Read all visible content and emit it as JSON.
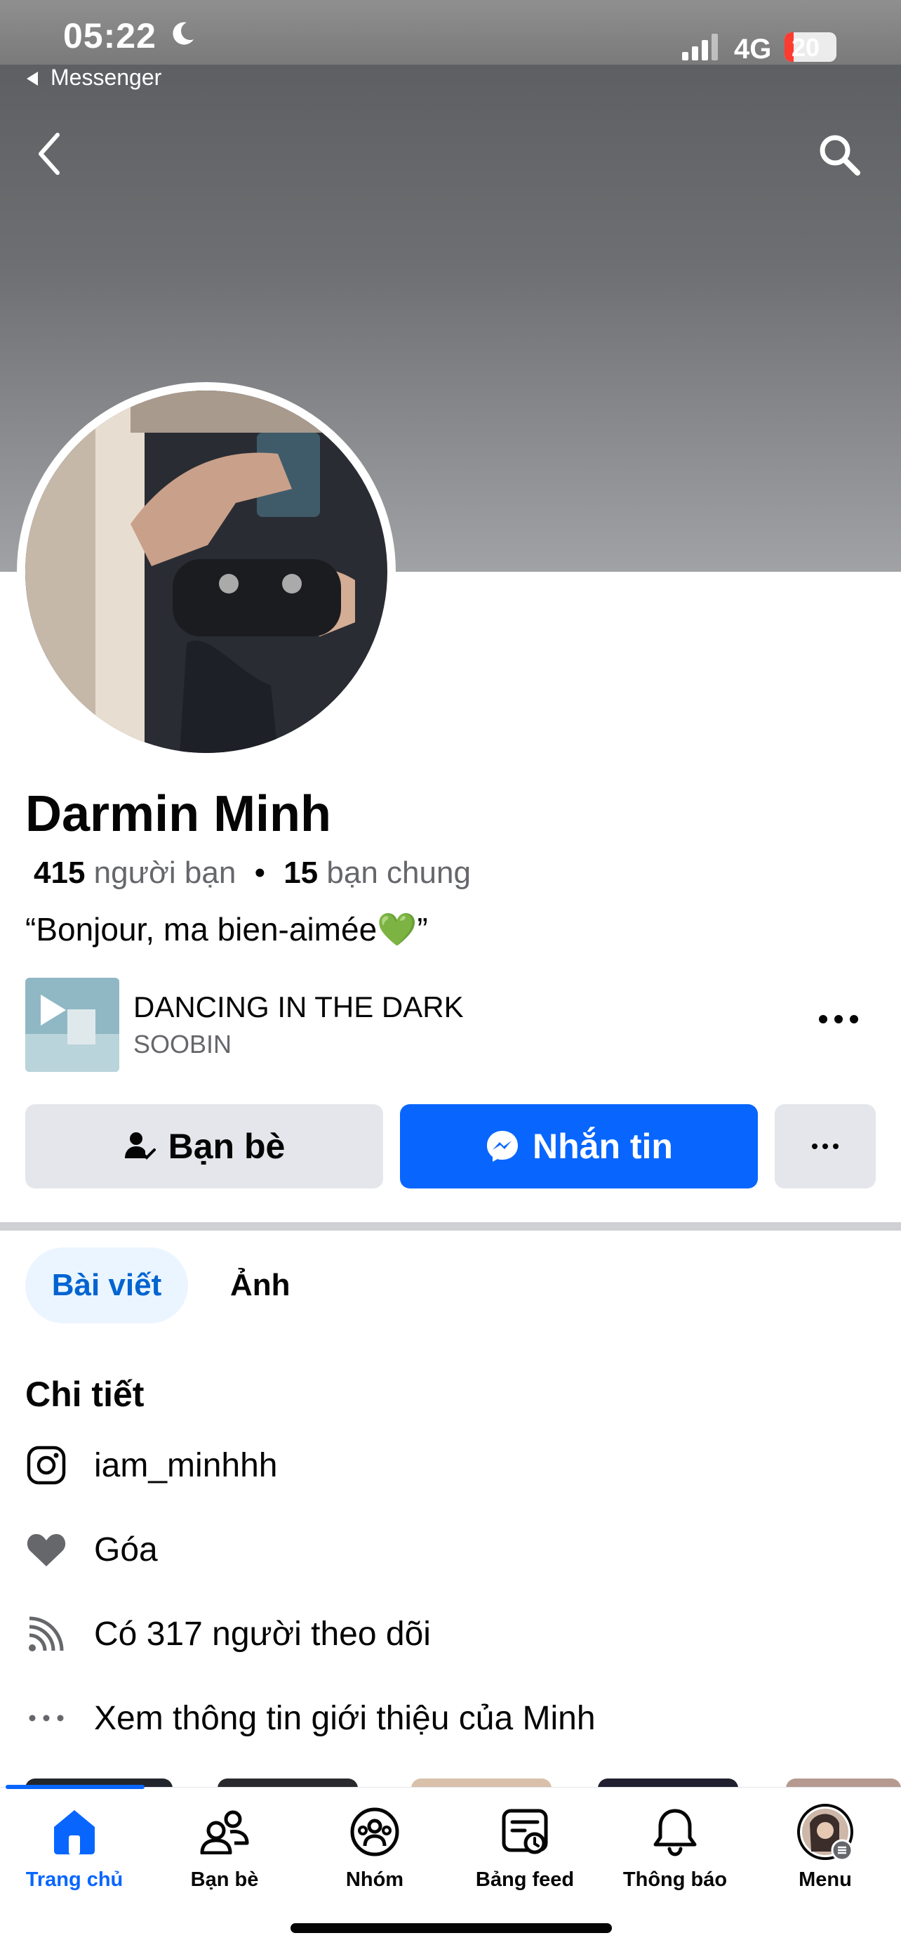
{
  "status_bar": {
    "time": "05:22",
    "network": "4G",
    "battery": "20",
    "back_app": "Messenger"
  },
  "profile": {
    "name": "Darmin Minh",
    "friends_count": "415",
    "friends_label": "người bạn",
    "mutual_count": "15",
    "mutual_label": "bạn chung",
    "bio": "“Bonjour, ma bien-aimée💚”"
  },
  "song": {
    "title": "DANCING IN THE DARK",
    "artist": "SOOBIN"
  },
  "actions": {
    "friends_label": "Bạn bè",
    "message_label": "Nhắn tin"
  },
  "tabs": [
    {
      "label": "Bài viết",
      "active": true
    },
    {
      "label": "Ảnh",
      "active": false
    }
  ],
  "details": {
    "title": "Chi tiết",
    "items": [
      {
        "icon": "instagram-icon",
        "text": "iam_minhhh"
      },
      {
        "icon": "heart-icon",
        "text": "Góa"
      },
      {
        "icon": "rss-icon",
        "text": "Có 317 người theo dõi"
      },
      {
        "icon": "more-dots-icon",
        "text": "Xem thông tin giới thiệu của Minh"
      }
    ]
  },
  "tab_bar": [
    {
      "label": "Trang chủ",
      "icon": "home-icon",
      "active": true
    },
    {
      "label": "Bạn bè",
      "icon": "friends-icon",
      "active": false
    },
    {
      "label": "Nhóm",
      "icon": "groups-icon",
      "active": false
    },
    {
      "label": "Bảng feed",
      "icon": "feed-icon",
      "active": false
    },
    {
      "label": "Thông báo",
      "icon": "bell-icon",
      "active": false
    },
    {
      "label": "Menu",
      "icon": "avatar-menu-icon",
      "active": false
    }
  ],
  "colors": {
    "accent": "#0866ff",
    "secondary_bg": "#e4e6eb",
    "muted_text": "#65676b"
  }
}
